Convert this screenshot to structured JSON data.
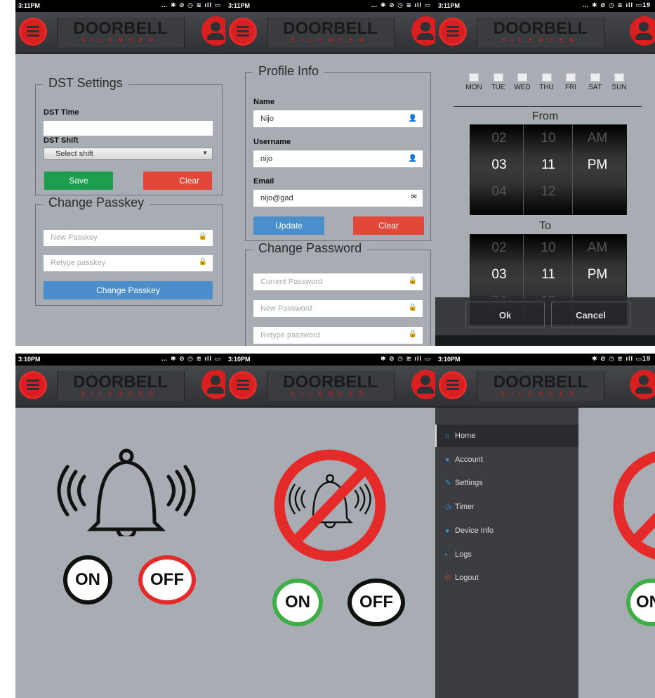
{
  "app": {
    "logo_main": "DOORBELL",
    "logo_sub": "SILENCER"
  },
  "screens": {
    "dst": {
      "time": "3:11PM",
      "dst_settings": {
        "legend": "DST Settings",
        "time_label": "DST Time",
        "shift_label": "DST Shift",
        "shift_value": "Select shift",
        "save": "Save",
        "clear": "Clear"
      },
      "change_passkey": {
        "legend": "Change Passkey",
        "new_placeholder": "New Passkey",
        "retype_placeholder": "Retype passkey",
        "button": "Change Passkey"
      }
    },
    "profile": {
      "time": "3:11PM",
      "profile_info": {
        "legend": "Profile Info",
        "name_label": "Name",
        "name_value": "Nijo",
        "username_label": "Username",
        "username_value": "nijo",
        "email_label": "Email",
        "email_value": "nijo@gad",
        "update": "Update",
        "clear": "Clear"
      },
      "change_password": {
        "legend": "Change Password",
        "current_placeholder": "Current Password",
        "new_placeholder": "New Password",
        "retype_placeholder": "Retype password"
      }
    },
    "timer": {
      "time": "3:11PM",
      "battery": "19",
      "days": [
        "MON",
        "TUE",
        "WED",
        "THU",
        "FRI",
        "SAT",
        "SUN"
      ],
      "from_label": "From",
      "to_label": "To",
      "hours": [
        "02",
        "03",
        "04"
      ],
      "minutes": [
        "10",
        "11",
        "12"
      ],
      "ampm": [
        "AM",
        "PM"
      ],
      "ok": "Ok",
      "cancel": "Cancel"
    },
    "home_on": {
      "time": "3:10PM",
      "on": "ON",
      "off": "OFF"
    },
    "home_off": {
      "time": "3:10PM",
      "on": "ON",
      "off": "OFF"
    },
    "drawer": {
      "time": "3:10PM",
      "battery": "19",
      "items": [
        {
          "label": "Home",
          "icon": "home-icon",
          "color": "#2f9be0"
        },
        {
          "label": "Account",
          "icon": "user-icon",
          "color": "#2f9be0"
        },
        {
          "label": "Settings",
          "icon": "wrench-icon",
          "color": "#2f9be0"
        },
        {
          "label": "Timer",
          "icon": "clock-icon",
          "color": "#2f9be0"
        },
        {
          "label": "Device Info",
          "icon": "device-icon",
          "color": "#2f9be0"
        },
        {
          "label": "Logs",
          "icon": "file-icon",
          "color": "#2f9be0"
        },
        {
          "label": "Logout",
          "icon": "power-icon",
          "color": "#e2473a"
        }
      ]
    }
  },
  "colors": {
    "accent_red": "#d91f1f",
    "on_green": "#3fae49",
    "bg": "#a8adb3",
    "dark": "#2f3134"
  }
}
